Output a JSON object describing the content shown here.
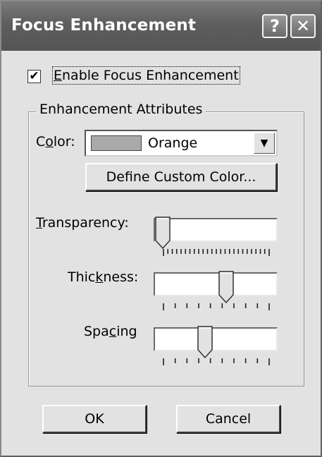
{
  "window": {
    "title": "Focus Enhancement",
    "help_glyph": "?",
    "close_glyph": "✕"
  },
  "enable_checkbox": {
    "label": "Enable Focus Enhancement",
    "checked": true,
    "glyph": "✔"
  },
  "group": {
    "legend": "Enhancement Attributes"
  },
  "color": {
    "label": "Color:",
    "selected": "Orange",
    "swatch_color": "#a9a9a9",
    "dropdown_glyph": "▼",
    "define_button": "Define Custom Color..."
  },
  "sliders": {
    "transparency": {
      "label": "Transparency:",
      "position_fraction": 0.0,
      "tick_count": 25
    },
    "thickness": {
      "label": "Thickness:",
      "position_fraction": 0.6,
      "tick_count": 10
    },
    "spacing": {
      "label": "Spacing",
      "position_fraction": 0.4,
      "tick_count": 10
    }
  },
  "buttons": {
    "ok": "OK",
    "cancel": "Cancel"
  }
}
